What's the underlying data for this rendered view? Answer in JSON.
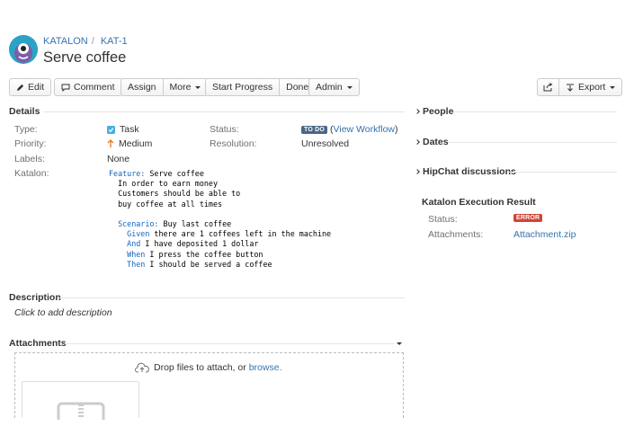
{
  "breadcrumb": {
    "project": "KATALON",
    "issue_key": "KAT-1"
  },
  "issue": {
    "title": "Serve coffee"
  },
  "toolbar": {
    "edit": "Edit",
    "comment": "Comment",
    "assign": "Assign",
    "more": "More",
    "start_progress": "Start Progress",
    "done": "Done",
    "admin": "Admin",
    "export": "Export"
  },
  "details": {
    "heading": "Details",
    "type_label": "Type:",
    "type_value": "Task",
    "priority_label": "Priority:",
    "priority_value": "Medium",
    "labels_label": "Labels:",
    "labels_value": "None",
    "status_label": "Status:",
    "status_value": "TO DO",
    "view_workflow": "View Workflow",
    "resolution_label": "Resolution:",
    "resolution_value": "Unresolved",
    "katalon_label": "Katalon:",
    "gherkin": [
      {
        "kw": "Feature:",
        "text": " Serve coffee"
      },
      {
        "kw": "",
        "text": "  In order to earn money"
      },
      {
        "kw": "",
        "text": "  Customers should be able to"
      },
      {
        "kw": "",
        "text": "  buy coffee at all times"
      },
      {
        "kw": "",
        "text": ""
      },
      {
        "kw": "Scenario:",
        "text": " Buy last coffee",
        "indent": "  "
      },
      {
        "kw": "Given",
        "text": " there are 1 coffees left in the machine",
        "indent": "    "
      },
      {
        "kw": "And",
        "text": " I have deposited 1 dollar",
        "indent": "    "
      },
      {
        "kw": "When",
        "text": " I press the coffee button",
        "indent": "    "
      },
      {
        "kw": "Then",
        "text": " I should be served a coffee",
        "indent": "    "
      }
    ]
  },
  "description": {
    "heading": "Description",
    "placeholder": "Click to add description"
  },
  "attachments": {
    "heading": "Attachments",
    "drop_text": "Drop files to attach, or ",
    "browse": "browse."
  },
  "sidebar": {
    "people": "People",
    "dates": "Dates",
    "hipchat": "HipChat discussions",
    "katalon_heading": "Katalon Execution Result",
    "status_label": "Status:",
    "status_value": "ERROR",
    "attachments_label": "Attachments:",
    "attachments_value": "Attachment.zip"
  },
  "colors": {
    "link": "#3572b0",
    "todo_lozenge": "#4a6785",
    "error_lozenge": "#d04437",
    "keyword": "#1565c0",
    "avatar": "#2ba3c6"
  }
}
